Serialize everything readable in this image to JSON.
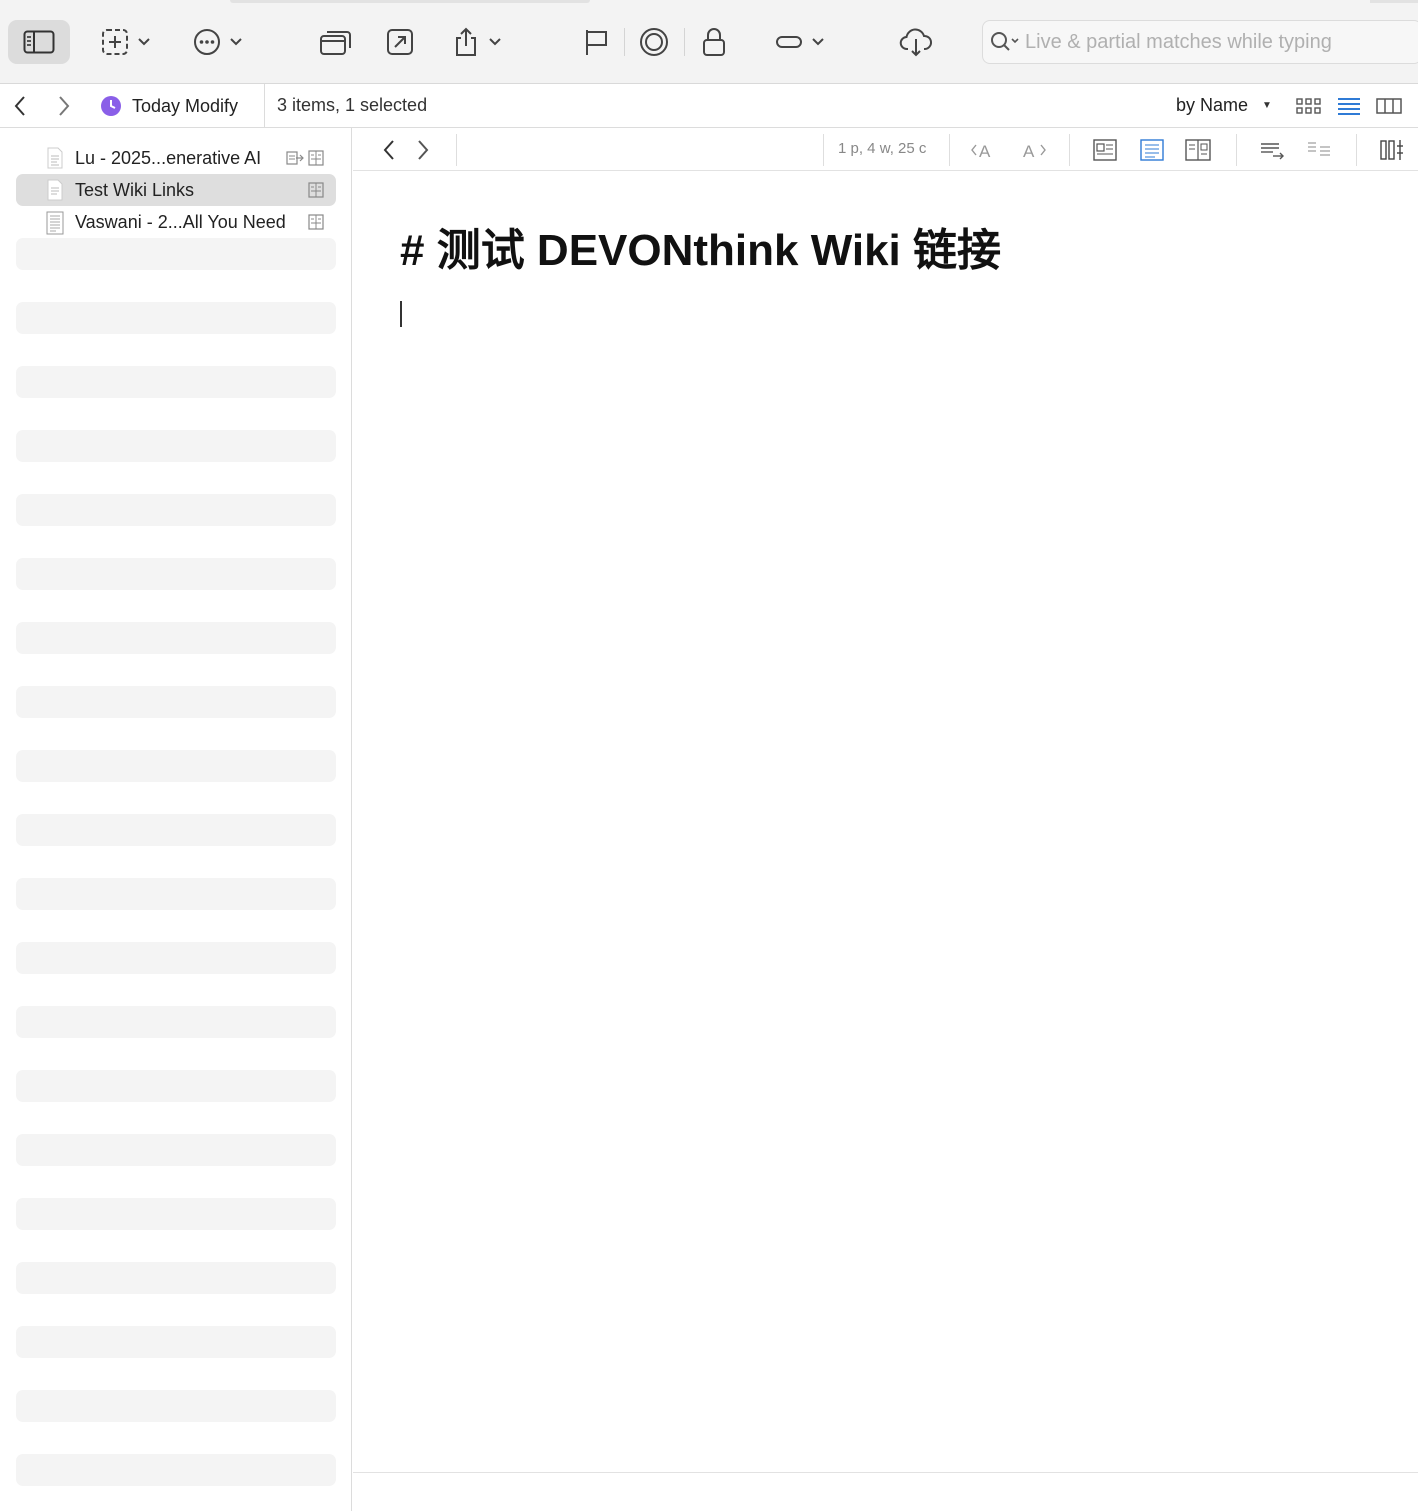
{
  "toolbar": {
    "search_placeholder": "Live & partial matches while typing",
    "icons": [
      "sidebar-icon",
      "new-item-icon",
      "more-actions-icon",
      "open-window-icon",
      "open-external-icon",
      "share-icon",
      "flag-icon",
      "mark-icon",
      "lock-icon",
      "label-icon",
      "sync-icon",
      "search-icon"
    ]
  },
  "pathbar": {
    "smart_group": "Today Modify",
    "status": "3 items, 1 selected",
    "sort_label": "by Name",
    "accent_color": "#2f7bd6",
    "smart_group_color": "#8a5fe8"
  },
  "sidebar": {
    "items": [
      {
        "label": "Lu - 2025...enerative AI",
        "selected": false
      },
      {
        "label": "Test Wiki Links",
        "selected": true
      },
      {
        "label": "Vaswani - 2...All You Need",
        "selected": false
      }
    ]
  },
  "editor": {
    "word_count": "1 p, 4 w, 25 c",
    "heading": "# 测试 DEVONthink Wiki 链接"
  }
}
